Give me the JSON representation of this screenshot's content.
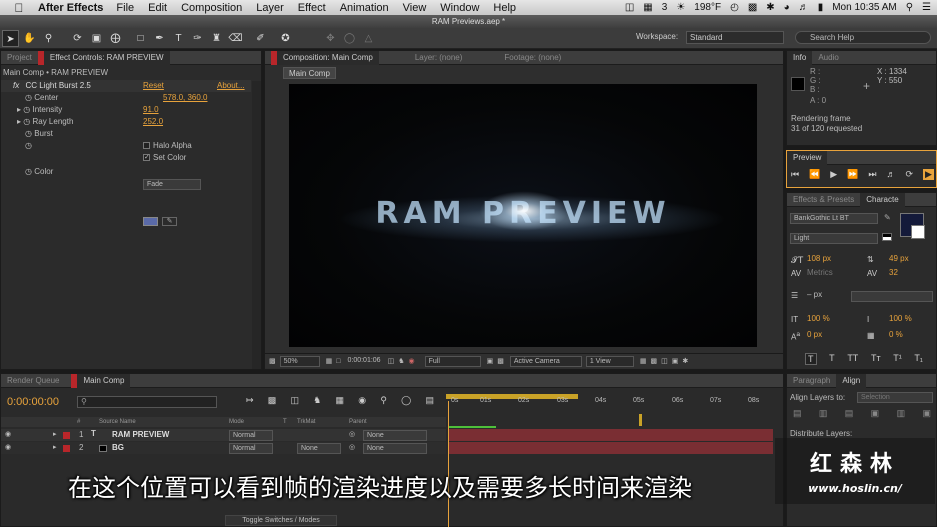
{
  "menubar": {
    "app_name": "After Effects",
    "items": [
      "File",
      "Edit",
      "Composition",
      "Layer",
      "Effect",
      "Animation",
      "View",
      "Window",
      "Help"
    ],
    "status": {
      "notifications": "3",
      "temperature": "198°F",
      "clock": "Mon 10:35 AM"
    }
  },
  "window": {
    "title": "RAM Previews.aep *"
  },
  "toolbar": {
    "workspace_label": "Workspace:",
    "workspace_value": "Standard",
    "search_placeholder": "Search Help"
  },
  "left_panel": {
    "tabs": [
      "Project",
      "Effect Controls: RAM PREVIEW"
    ],
    "breadcrumb": "Main Comp • RAM PREVIEW",
    "effect_name": "CC Light Burst 2.5",
    "reset_label": "Reset",
    "about_label": "About...",
    "props": [
      {
        "name": "Center",
        "value": "578.0, 360.0"
      },
      {
        "name": "Intensity",
        "value": "91.0"
      },
      {
        "name": "Ray Length",
        "value": "252.0"
      },
      {
        "name": "Burst",
        "value": "Fade"
      },
      {
        "name": "",
        "value": "Halo Alpha"
      },
      {
        "name": "",
        "value": "Set Color"
      },
      {
        "name": "Color",
        "value": ""
      }
    ]
  },
  "composition": {
    "tabs": [
      "Composition: Main Comp",
      "Layer: (none)",
      "Footage: (none)"
    ],
    "comp_tab": "Main Comp",
    "viewer_text": "RAM PREVIEW",
    "zoom": "50%",
    "timecode": "0:00:01:06",
    "resolution": "Full",
    "camera": "Active Camera",
    "views": "1 View"
  },
  "info_panel": {
    "tabs": [
      "Info",
      "Audio"
    ],
    "r_label": "R :",
    "g_label": "G :",
    "b_label": "B :",
    "a_label": "A : 0",
    "x_label": "X : 1334",
    "y_label": "Y : 550",
    "status_line1": "Rendering frame",
    "status_line2": "31 of 120 requested"
  },
  "preview_panel": {
    "tab": "Preview"
  },
  "character_panel": {
    "tabs": [
      "Effects & Presets",
      "Characte"
    ],
    "font": "BankGothic Lt BT",
    "style": "Light",
    "size": "108 px",
    "leading": "49 px",
    "kerning": "Metrics",
    "tracking": "32",
    "indent": "– px",
    "v_scale": "100 %",
    "h_scale": "100 %",
    "baseline": "0 px",
    "tsume": "0 %"
  },
  "timeline": {
    "tabs": [
      "Render Queue",
      "Main Comp"
    ],
    "timecode": "0:00:00:00",
    "columns": [
      "#",
      "Source Name",
      "Mode",
      "T",
      "TrkMat",
      "Parent"
    ],
    "layers": [
      {
        "num": "1",
        "name": "RAM PREVIEW",
        "mode": "Normal",
        "trkmat": "",
        "parent": "None"
      },
      {
        "num": "2",
        "name": "BG",
        "mode": "Normal",
        "trkmat": "None",
        "parent": "None"
      }
    ],
    "ruler": [
      "0s",
      "01s",
      "02s",
      "03s",
      "04s",
      "05s",
      "06s",
      "07s",
      "08s"
    ],
    "toggle_label": "Toggle Switches / Modes"
  },
  "right_bottom": {
    "tabs": [
      "Paragraph",
      "Align"
    ],
    "align_label": "Align Layers to:",
    "align_value": "Selection",
    "distribute_label": "Distribute Layers:"
  },
  "overlay": {
    "subtitle": "在这个位置可以看到帧的渲染进度以及需要多长时间来渲染",
    "watermark_cn": "红森林",
    "watermark_url": "www.hoslin.cn/"
  },
  "colors": {
    "accent": "#e8a33c",
    "layer_red": "#b8262a",
    "timeline_bar": "#7a2e33"
  }
}
